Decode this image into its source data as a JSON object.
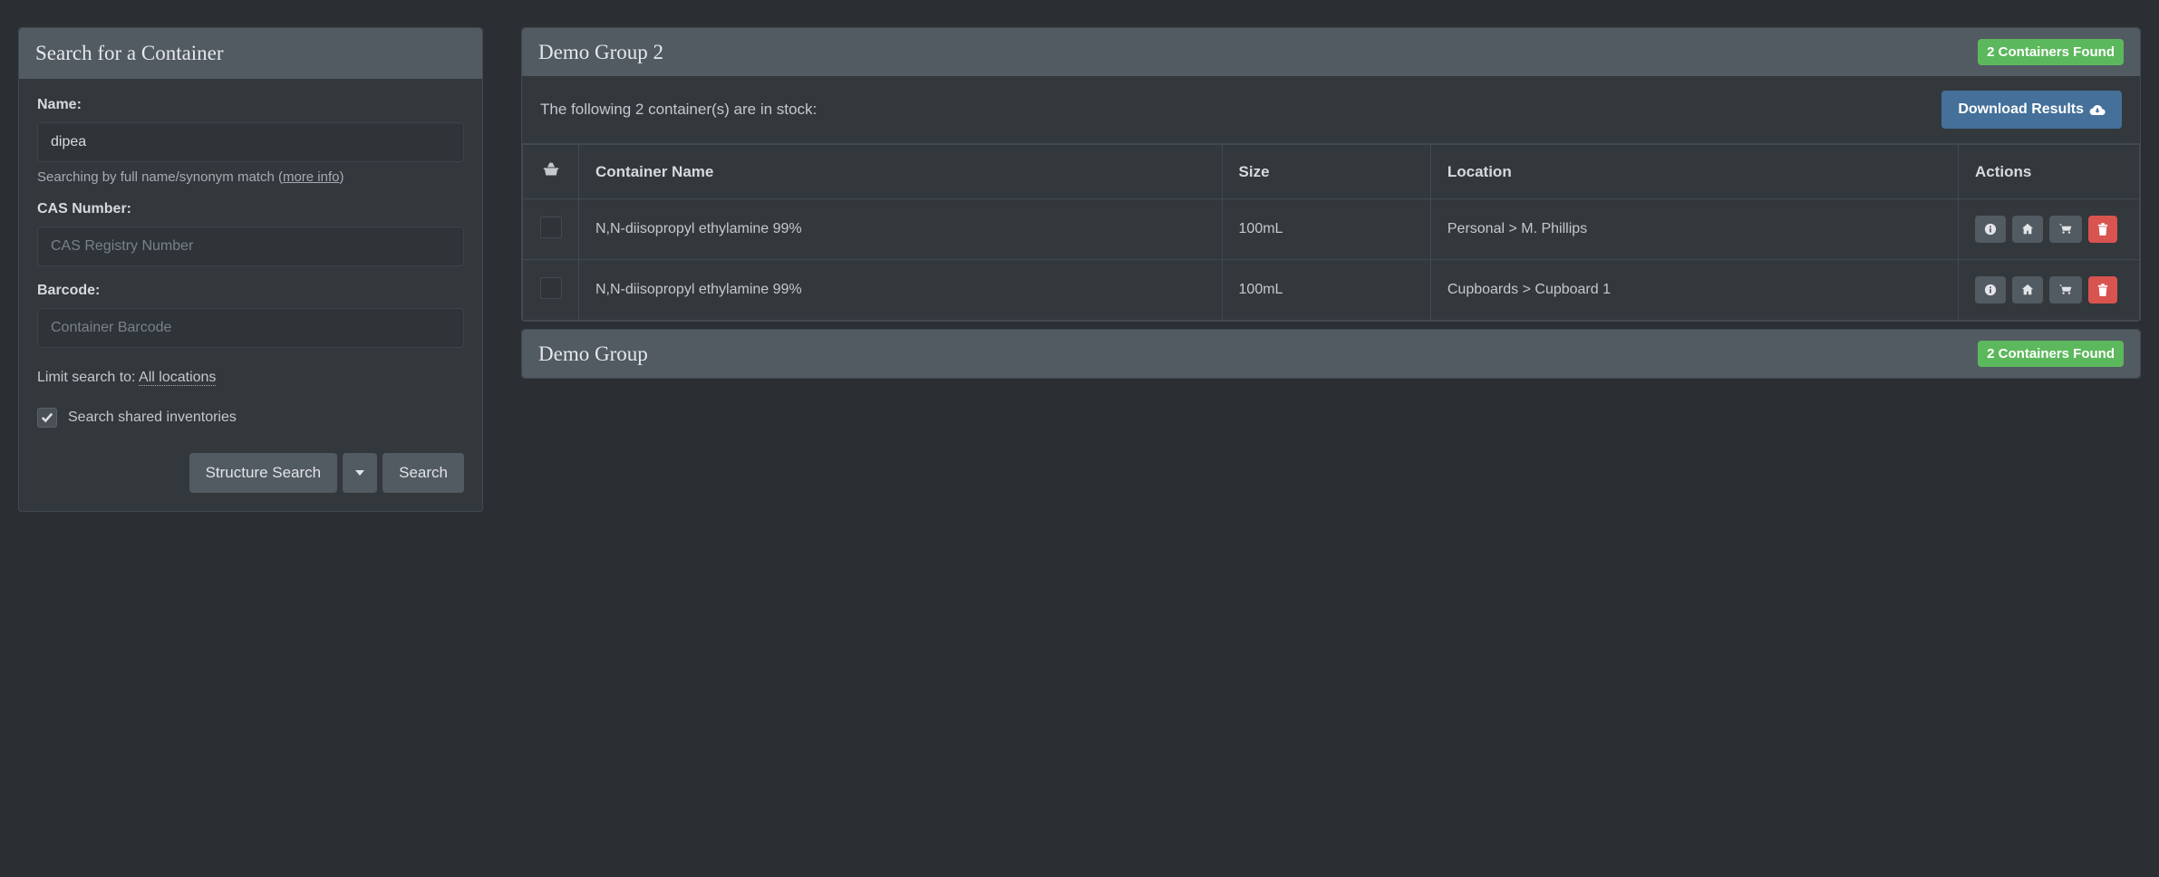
{
  "search": {
    "title": "Search for a Container",
    "name_label": "Name:",
    "name_value": "dipea",
    "name_help_prefix": "Searching by full name/synonym match (",
    "name_help_link": "more info",
    "name_help_suffix": ")",
    "cas_label": "CAS Number:",
    "cas_placeholder": "CAS Registry Number",
    "barcode_label": "Barcode:",
    "barcode_placeholder": "Container Barcode",
    "limit_prefix": "Limit search to: ",
    "limit_value": "All locations",
    "shared_label": "Search shared inventories",
    "structure_btn": "Structure Search",
    "search_btn": "Search"
  },
  "groups": [
    {
      "title": "Demo Group 2",
      "badge": "2 Containers Found",
      "stock_msg": "The following 2 container(s) are in stock:",
      "download_label": "Download Results",
      "headers": {
        "name": "Container Name",
        "size": "Size",
        "location": "Location",
        "actions": "Actions"
      },
      "rows": [
        {
          "name": "N,N-diisopropyl ethylamine 99%",
          "size": "100mL",
          "location": "Personal > M. Phillips"
        },
        {
          "name": "N,N-diisopropyl ethylamine 99%",
          "size": "100mL",
          "location": "Cupboards > Cupboard 1"
        }
      ]
    },
    {
      "title": "Demo Group",
      "badge": "2 Containers Found"
    }
  ]
}
